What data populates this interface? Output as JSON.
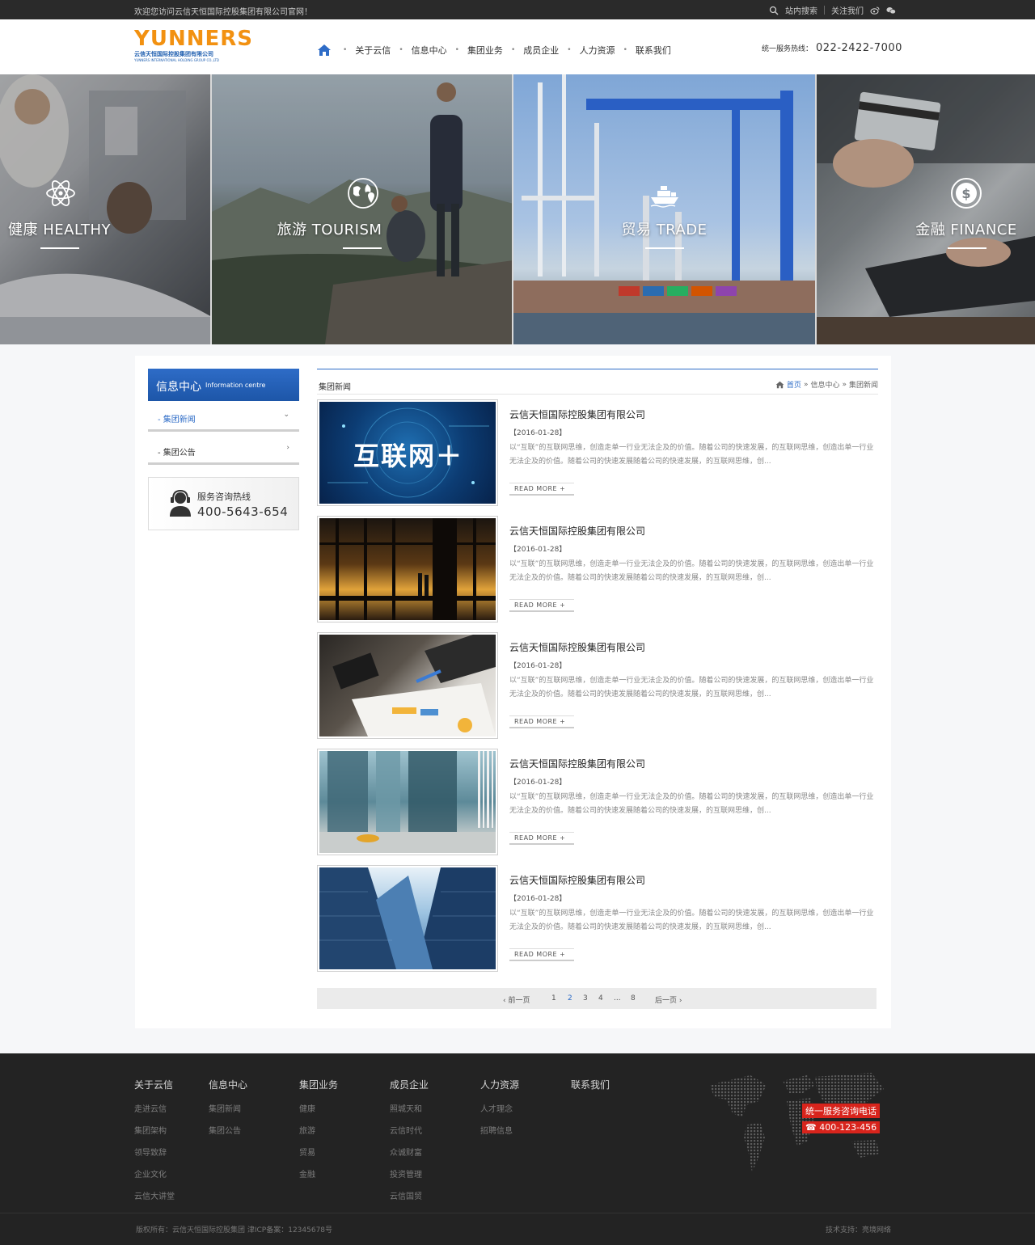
{
  "topbar": {
    "welcome": "欢迎您访问云信天恒国际控股集团有限公司官网！",
    "search": "站内搜索",
    "follow": "关注我们"
  },
  "header": {
    "logo_text": "YUNNERS",
    "logo_cn": "云信天恒国际控股集团有限公司",
    "logo_en": "YUNNERS INTERNATIONAL HOLDING GROUP CO.,LTD",
    "nav": [
      "关于云信",
      "信息中心",
      "集团业务",
      "成员企业",
      "人力资源",
      "联系我们"
    ],
    "hotline_label": "统一服务热线：",
    "hotline_number": "022-2422-7000"
  },
  "banner": [
    {
      "label": "健康 HEALTHY",
      "icon": "atom-icon"
    },
    {
      "label": "旅游 TOURISM",
      "icon": "globe-pin-icon"
    },
    {
      "label": "贸易 TRADE",
      "icon": "ship-icon"
    },
    {
      "label": "金融 FINANCE",
      "icon": "dollar-icon"
    }
  ],
  "sidebar": {
    "title_cn": "信息中心",
    "title_en": "Information centre",
    "items": [
      {
        "label": "- 集团新闻",
        "arrow": "⌄"
      },
      {
        "label": "- 集团公告",
        "arrow": "›"
      }
    ],
    "service_label": "服务咨询热线",
    "service_number": "400-5643-654"
  },
  "main": {
    "title": "集团新闻",
    "breadcrumb": {
      "home": "首页",
      "sep1": "»",
      "level1": "信息中心",
      "sep2": "»",
      "level2": "集团新闻"
    },
    "news": [
      {
        "title": "云信天恒国际控股集团有限公司",
        "date": "【2016-01-28】",
        "desc": "以“互联”的互联网思维，创造走单一行业无法企及的价值。随着公司的快速发展，的互联网思维，创造出单一行业无法企及的价值。随着公司的快速发展随着公司的快速发展，的互联网思维，创...",
        "more": "READ MORE +",
        "image_text": "互联网＋"
      },
      {
        "title": "云信天恒国际控股集团有限公司",
        "date": "【2016-01-28】",
        "desc": "以“互联”的互联网思维，创造走单一行业无法企及的价值。随着公司的快速发展，的互联网思维，创造出单一行业无法企及的价值。随着公司的快速发展随着公司的快速发展，的互联网思维，创...",
        "more": "READ MORE +"
      },
      {
        "title": "云信天恒国际控股集团有限公司",
        "date": "【2016-01-28】",
        "desc": "以“互联”的互联网思维，创造走单一行业无法企及的价值。随着公司的快速发展，的互联网思维，创造出单一行业无法企及的价值。随着公司的快速发展随着公司的快速发展，的互联网思维，创...",
        "more": "READ MORE +"
      },
      {
        "title": "云信天恒国际控股集团有限公司",
        "date": "【2016-01-28】",
        "desc": "以“互联”的互联网思维，创造走单一行业无法企及的价值。随着公司的快速发展，的互联网思维，创造出单一行业无法企及的价值。随着公司的快速发展随着公司的快速发展，的互联网思维，创...",
        "more": "READ MORE +"
      },
      {
        "title": "云信天恒国际控股集团有限公司",
        "date": "【2016-01-28】",
        "desc": "以“互联”的互联网思维，创造走单一行业无法企及的价值。随着公司的快速发展，的互联网思维，创造出单一行业无法企及的价值。随着公司的快速发展随着公司的快速发展，的互联网思维，创...",
        "more": "READ MORE +"
      }
    ],
    "pager": {
      "prev": "‹ 前一页",
      "pages": [
        "1",
        "2",
        "3",
        "4",
        "...",
        "8"
      ],
      "current": "2",
      "next": "后一页 ›"
    }
  },
  "footer": {
    "columns": [
      {
        "title": "关于云信",
        "links": [
          "走进云信",
          "集团架构",
          "领导致辞",
          "企业文化",
          "云信大讲堂"
        ]
      },
      {
        "title": "信息中心",
        "links": [
          "集团新闻",
          "集团公告"
        ]
      },
      {
        "title": "集团业务",
        "links": [
          "健康",
          "旅游",
          "贸易",
          "金融"
        ]
      },
      {
        "title": "成员企业",
        "links": [
          "照城天和",
          "云信时代",
          "众诚财富",
          "投资管理",
          "云信国贸"
        ]
      },
      {
        "title": "人力资源",
        "links": [
          "人才理念",
          "招聘信息"
        ]
      },
      {
        "title": "联系我们",
        "links": []
      }
    ],
    "hotline_title": "统一服务咨询电话",
    "hotline_number": "400-123-456",
    "copyright": "版权所有：云信天恒国际控股集团 津ICP备案：12345678号",
    "tech": "技术支持：亮境网络"
  },
  "colors": {
    "brand_blue": "#2e6cc7",
    "logo_orange": "#f29111",
    "footer_bg": "#232323",
    "hotline_red": "#d8241c"
  }
}
